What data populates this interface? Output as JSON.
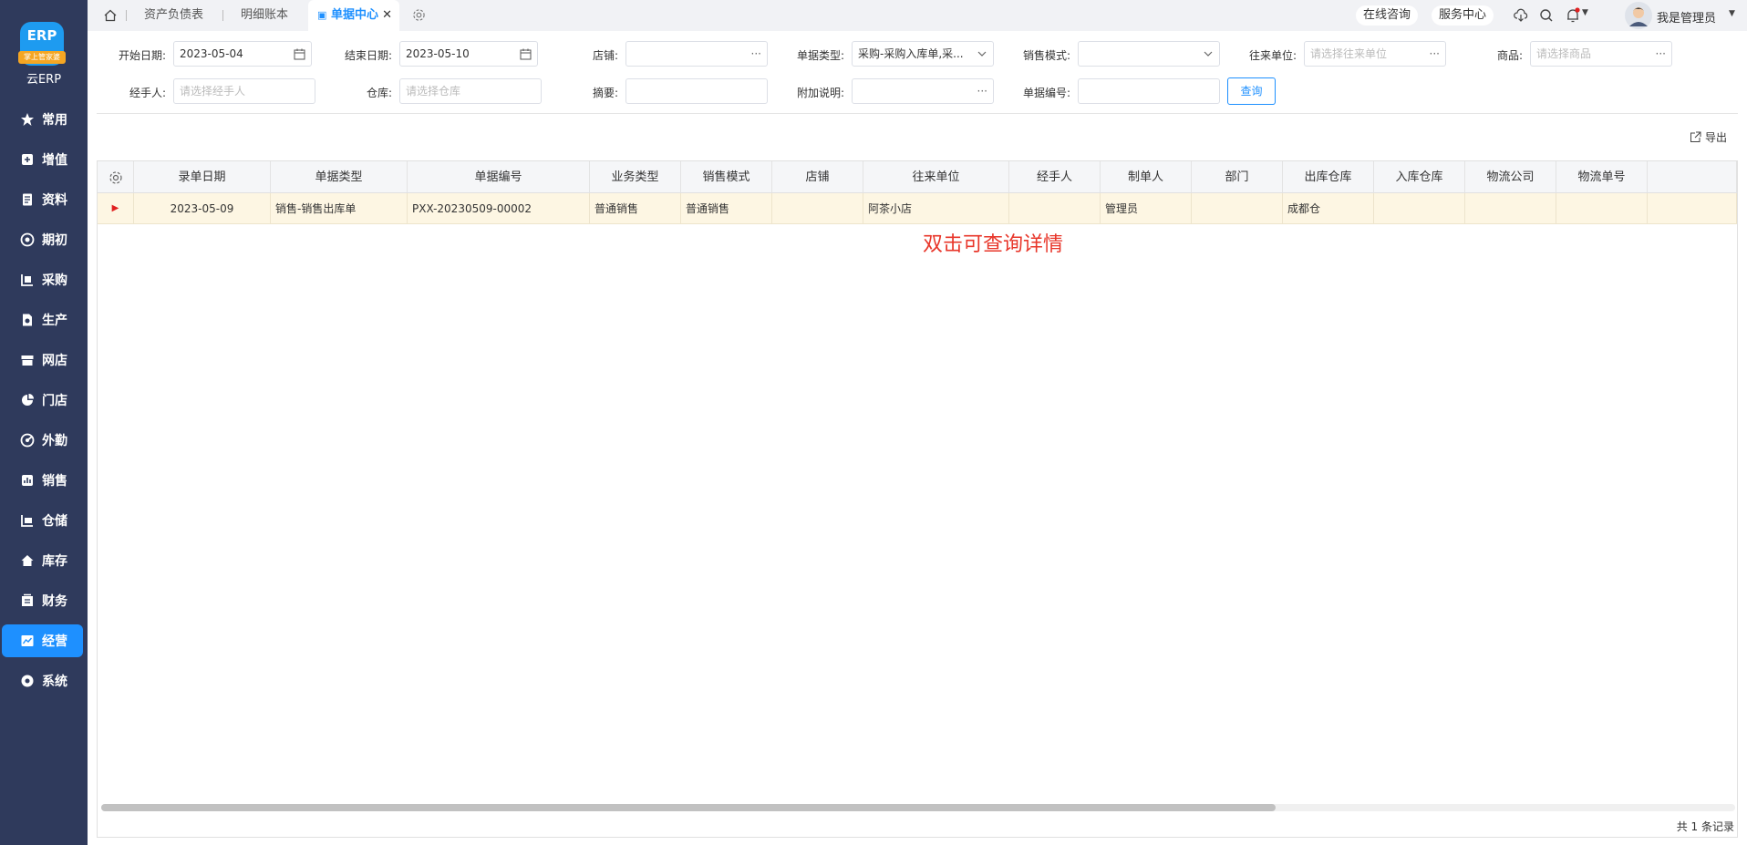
{
  "app": {
    "name": "云ERP",
    "badge": "掌上管家婆"
  },
  "nav": [
    {
      "label": "常用",
      "icon": "star-icon"
    },
    {
      "label": "增值",
      "icon": "plus-square-icon"
    },
    {
      "label": "资料",
      "icon": "document-icon"
    },
    {
      "label": "期初",
      "icon": "target-icon"
    },
    {
      "label": "采购",
      "icon": "purchase-icon"
    },
    {
      "label": "生产",
      "icon": "production-icon"
    },
    {
      "label": "网店",
      "icon": "store-icon"
    },
    {
      "label": "门店",
      "icon": "pie-icon"
    },
    {
      "label": "外勤",
      "icon": "field-icon"
    },
    {
      "label": "销售",
      "icon": "sales-icon"
    },
    {
      "label": "仓储",
      "icon": "warehouse-icon"
    },
    {
      "label": "库存",
      "icon": "home-icon"
    },
    {
      "label": "财务",
      "icon": "finance-icon"
    },
    {
      "label": "经营",
      "icon": "business-icon",
      "active": true
    },
    {
      "label": "系统",
      "icon": "settings-icon"
    }
  ],
  "tabs": [
    {
      "label": "资产负债表"
    },
    {
      "label": "明细账本"
    },
    {
      "label": "单据中心",
      "active": true
    }
  ],
  "top_right": {
    "consult": "在线咨询",
    "service": "服务中心",
    "user": "我是管理员"
  },
  "filters": {
    "start_date": {
      "label": "开始日期:",
      "value": "2023-05-04"
    },
    "end_date": {
      "label": "结束日期:",
      "value": "2023-05-10"
    },
    "shop": {
      "label": "店铺:",
      "value": ""
    },
    "bill_type": {
      "label": "单据类型:",
      "value": "采购-采购入库单,采..."
    },
    "sale_mode": {
      "label": "销售模式:",
      "value": ""
    },
    "partner": {
      "label": "往来单位:",
      "placeholder": "请选择往来单位"
    },
    "goods": {
      "label": "商品:",
      "placeholder": "请选择商品"
    },
    "handler": {
      "label": "经手人:",
      "placeholder": "请选择经手人"
    },
    "warehouse": {
      "label": "仓库:",
      "placeholder": "请选择仓库"
    },
    "summary": {
      "label": "摘要:",
      "value": ""
    },
    "extra": {
      "label": "附加说明:",
      "value": ""
    },
    "bill_no": {
      "label": "单据编号:",
      "value": ""
    }
  },
  "query_label": "查询",
  "export_label": "导出",
  "columns": [
    "录单日期",
    "单据类型",
    "单据编号",
    "业务类型",
    "销售模式",
    "店铺",
    "往来单位",
    "经手人",
    "制单人",
    "部门",
    "出库仓库",
    "入库仓库",
    "物流公司",
    "物流单号"
  ],
  "rows": [
    [
      "2023-05-09",
      "销售-销售出库单",
      "PXX-20230509-00002",
      "普通销售",
      "普通销售",
      "",
      "阿茶小店",
      "",
      "管理员",
      "",
      "成都仓",
      "",
      "",
      ""
    ]
  ],
  "hint": "双击可查询详情",
  "footer": "共 1 条记录",
  "colors": {
    "sidebar": "#2f3a5c",
    "accent": "#1e90ff",
    "hint": "#e8362a",
    "row_selected": "#fdf6e3"
  }
}
